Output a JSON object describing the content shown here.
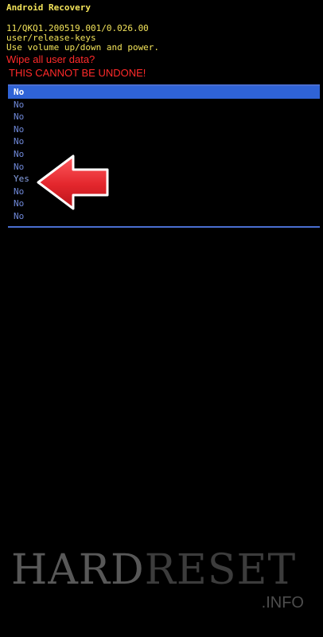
{
  "header": {
    "title": "Android Recovery",
    "build": "11/QKQ1.200519.001/0.026.00",
    "keys": "user/release-keys",
    "instructions": "Use volume up/down and power."
  },
  "warning": {
    "question": "Wipe all user data?",
    "undone": "THIS CANNOT BE UNDONE!"
  },
  "menu": {
    "selected_index": 0,
    "items": [
      {
        "label": "No"
      },
      {
        "label": "No"
      },
      {
        "label": "No"
      },
      {
        "label": "No"
      },
      {
        "label": "No"
      },
      {
        "label": "No"
      },
      {
        "label": "No"
      },
      {
        "label": "Yes"
      },
      {
        "label": "No"
      },
      {
        "label": "No"
      },
      {
        "label": "No"
      }
    ]
  },
  "annotation": {
    "arrow_icon": "left-arrow-icon",
    "arrow_color": "#e3262c"
  },
  "watermark": {
    "main_part1": "HARD",
    "main_part2": "RESET",
    "sub": ".INFO"
  },
  "colors": {
    "header_text": "#f2e35a",
    "warning_text": "#ff2a2a",
    "menu_text": "#6f88d8",
    "menu_selected_bg": "#2f63d6"
  }
}
